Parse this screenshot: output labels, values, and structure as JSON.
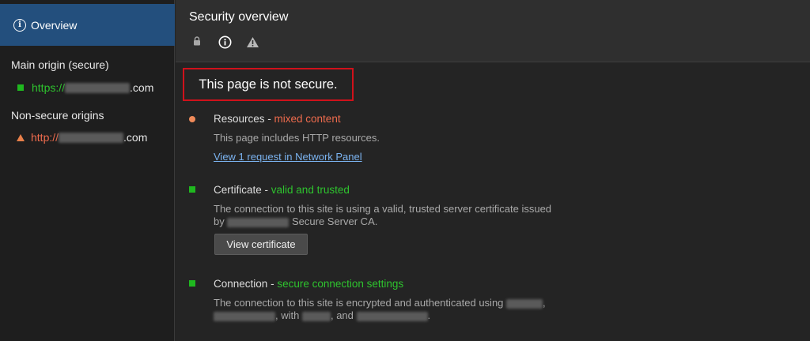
{
  "sidebar": {
    "overview_label": "Overview",
    "main_origin_heading": "Main origin (secure)",
    "main_origin_scheme": "https://",
    "main_origin_suffix": ".com",
    "nonsecure_heading": "Non-secure origins",
    "nonsecure_scheme": "http://",
    "nonsecure_suffix": ".com"
  },
  "header": {
    "title": "Security overview",
    "icons": [
      "lock-icon",
      "info-icon",
      "warning-icon"
    ]
  },
  "summary": {
    "text": "This page is not secure."
  },
  "resources": {
    "title": "Resources",
    "separator": " - ",
    "status": "mixed content",
    "description": "This page includes HTTP resources.",
    "link": "View 1 request in Network Panel"
  },
  "certificate": {
    "title": "Certificate",
    "separator": " - ",
    "status": "valid and trusted",
    "desc_line1": "The connection to this site is using a valid, trusted server certificate issued",
    "desc_line2_prefix": "by",
    "desc_line2_suffix": "Secure Server CA.",
    "button": "View certificate"
  },
  "connection": {
    "title": "Connection",
    "separator": " - ",
    "status": "secure connection settings",
    "desc_line1": "The connection to this site is encrypted and authenticated using",
    "desc_line1_end": ",",
    "desc_line2_with": ", with",
    "desc_line2_and": ", and",
    "desc_line2_end": "."
  },
  "colors": {
    "accent_selected": "#234f7d",
    "secure_green": "#2ec32e",
    "mixed_orange": "#ee6b4d",
    "highlight_red": "#d0111b",
    "link_blue": "#7bb3f0"
  }
}
